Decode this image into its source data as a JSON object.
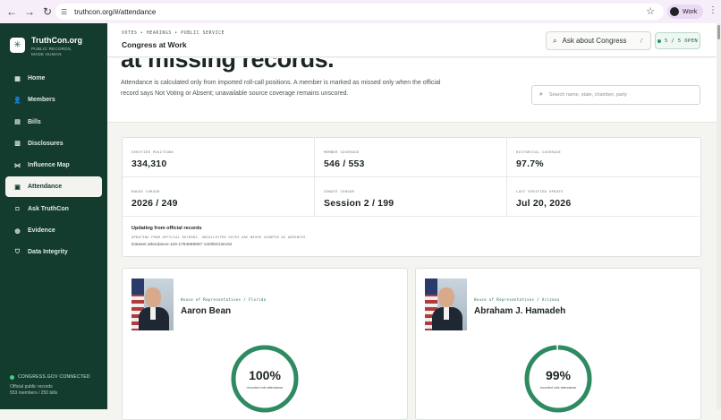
{
  "browser": {
    "url": "truthcon.org/#/attendance",
    "profile": "Work"
  },
  "sidebar": {
    "brand_name": "TruthCon.org",
    "brand_tagline": "PUBLIC RECORDS, MADE HUMAN",
    "items": [
      {
        "label": "Home",
        "icon": "home-icon"
      },
      {
        "label": "Members",
        "icon": "members-icon"
      },
      {
        "label": "Bills",
        "icon": "bills-icon"
      },
      {
        "label": "Disclosures",
        "icon": "disclosures-icon"
      },
      {
        "label": "Influence Map",
        "icon": "influence-map-icon"
      },
      {
        "label": "Attendance",
        "icon": "attendance-icon"
      },
      {
        "label": "Ask TruthCon",
        "icon": "ask-icon"
      },
      {
        "label": "Evidence",
        "icon": "evidence-icon"
      },
      {
        "label": "Data Integrity",
        "icon": "data-integrity-icon"
      }
    ],
    "active_index": 5,
    "connection": "CONGRESS.GOV CONNECTED",
    "footer_line1": "Official public records",
    "footer_line2": "553 members / 250 bills"
  },
  "header": {
    "breadcrumb": "VOTES • HEARINGS • PUBLIC SERVICE",
    "title": "Congress at Work",
    "ask_label": "Ask about Congress",
    "ask_shortcut": "/",
    "open_badge": "5 / 5 OPEN"
  },
  "hero": {
    "heading": "at missing records.",
    "description": "Attendance is calculated only from imported roll-call positions. A member is marked as missed only when the official record says Not Voting or Absent; unavailable source coverage remains unscored.",
    "search_placeholder": "Search name, state, chamber, party"
  },
  "stats": {
    "cells": [
      {
        "label": "VERIFIED POSITIONS",
        "value": "334,310"
      },
      {
        "label": "MEMBER COVERAGE",
        "value": "546 / 553"
      },
      {
        "label": "HISTORICAL COVERAGE",
        "value": "97.7%"
      },
      {
        "label": "HOUSE CURSOR",
        "value": "2026 / 249"
      },
      {
        "label": "SENATE CURSOR",
        "value": "Session 2 / 199"
      },
      {
        "label": "LAST VERIFIED UPDATE",
        "value": "Jul 20, 2026"
      }
    ],
    "update_title": "Updating from official records",
    "update_sub": "UPDATING FROM OFFICIAL RECORDS. UNCOLLECTED VOTES ARE NEVER COUNTED AS ABSENCES.",
    "dataset": "Dataset attendance-119-1784586567-1400b313ec52"
  },
  "chart_data": [
    {
      "type": "pie",
      "title": "Aaron Bean",
      "subtitle": "House of Representatives / Florida",
      "values": [
        100
      ],
      "value_label": "100%",
      "caption": "recorded vote attendance"
    },
    {
      "type": "pie",
      "title": "Abraham J. Hamadeh",
      "subtitle": "House of Representatives / Arizona",
      "values": [
        99
      ],
      "value_label": "99%",
      "caption": "recorded vote attendance"
    }
  ],
  "colors": {
    "sidebar": "#133c2e",
    "accent": "#1d6b4b",
    "ring": "#2e8a60",
    "ring_track": "#e3ebe6"
  }
}
